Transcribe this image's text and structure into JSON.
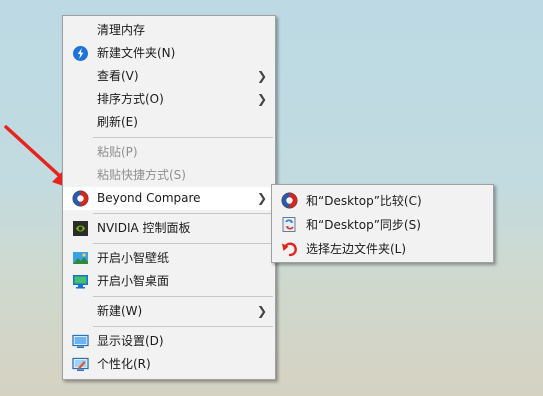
{
  "main_menu": {
    "items": [
      {
        "label": "清理内存"
      },
      {
        "label": "新建文件夹(N)",
        "icon": "blue-circle-folder-icon"
      },
      {
        "label": "查看(V)"
      },
      {
        "label": "排序方式(O)"
      },
      {
        "label": "刷新(E)"
      },
      {
        "label": "粘贴(P)"
      },
      {
        "label": "粘贴快捷方式(S)"
      },
      {
        "label": "Beyond Compare",
        "icon": "beyond-compare-icon"
      },
      {
        "label": "NVIDIA 控制面板",
        "icon": "nvidia-icon"
      },
      {
        "label": "开启小智壁纸",
        "icon": "wallpaper-icon"
      },
      {
        "label": "开启小智桌面",
        "icon": "desktop-monitor-icon"
      },
      {
        "label": "新建(W)"
      },
      {
        "label": "显示设置(D)",
        "icon": "display-icon"
      },
      {
        "label": "个性化(R)",
        "icon": "personalize-icon"
      }
    ]
  },
  "sub_menu": {
    "items": [
      {
        "label": "和“Desktop”比较(C)",
        "icon": "beyond-compare-icon"
      },
      {
        "label": "和“Desktop”同步(S)",
        "icon": "sync-icon"
      },
      {
        "label": "选择左边文件夹(L)",
        "icon": "undo-arrow-icon"
      }
    ]
  },
  "colors": {
    "menu_bg": "#f2f2f2",
    "hover_bg": "#ffffff",
    "arrow": "#e8231f"
  }
}
